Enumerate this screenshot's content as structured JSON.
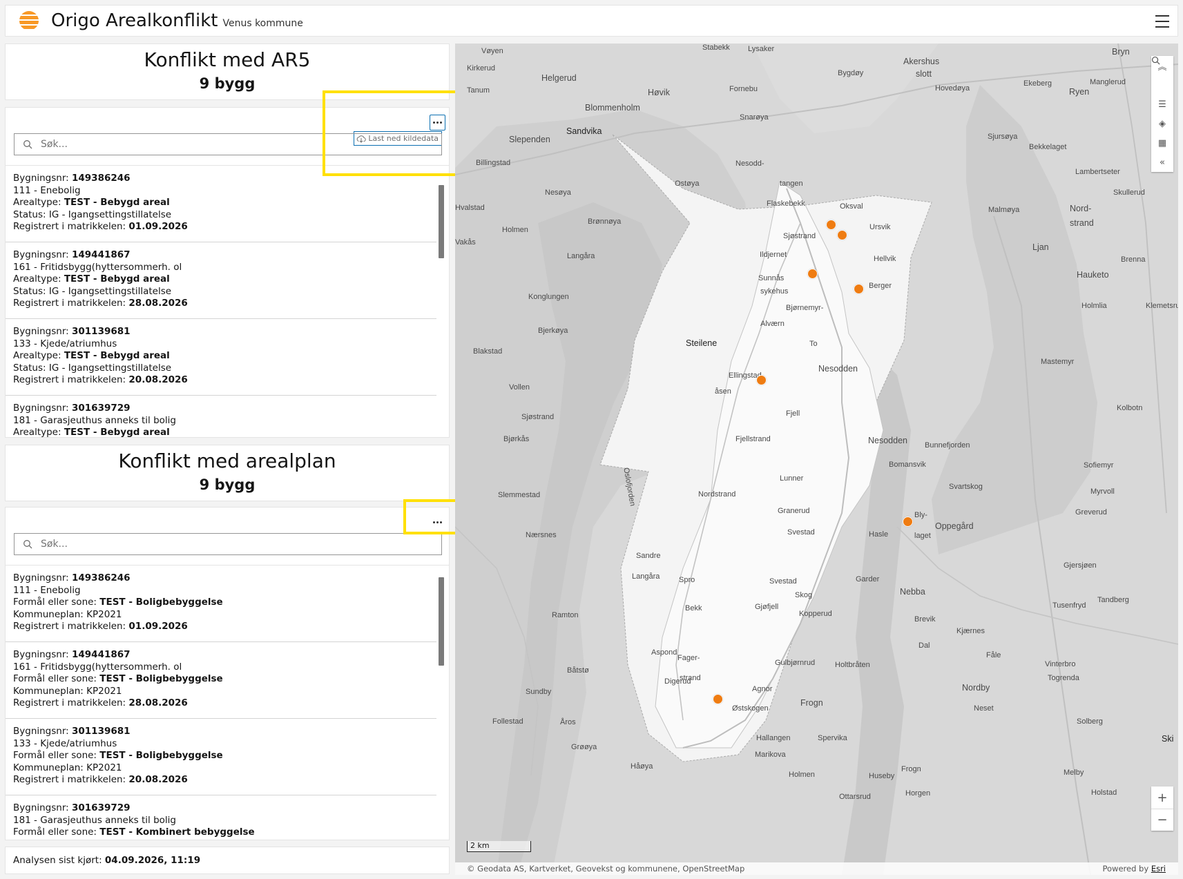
{
  "header": {
    "title": "Origo Arealkonflikt",
    "subtitle": "Venus kommune"
  },
  "ar5": {
    "title": "Konflikt med AR5",
    "count": "9 bygg",
    "download_label": "Last ned kildedata",
    "search_placeholder": "Søk...",
    "items": [
      {
        "l1": "Bygningsnr: ",
        "v1": "149386246",
        "l2": "111 - Enebolig",
        "l3": "Arealtype: ",
        "v3": "TEST - Bebygd areal",
        "l4": "Status: IG - Igangsettingstillatelse",
        "l5": "Registrert i matrikkelen: ",
        "v5": "01.09.2026"
      },
      {
        "l1": "Bygningsnr: ",
        "v1": "149441867",
        "l2": "161 - Fritidsbygg(hyttersommerh. ol",
        "l3": "Arealtype: ",
        "v3": "TEST - Bebygd areal",
        "l4": "Status: IG - Igangsettingstillatelse",
        "l5": "Registrert i matrikkelen: ",
        "v5": "28.08.2026"
      },
      {
        "l1": "Bygningsnr: ",
        "v1": "301139681",
        "l2": "133 - Kjede/atriumhus",
        "l3": "Arealtype: ",
        "v3": "TEST - Bebygd areal",
        "l4": "Status: IG - Igangsettingstillatelse",
        "l5": "Registrert i matrikkelen: ",
        "v5": "20.08.2026"
      },
      {
        "l1": "Bygningsnr: ",
        "v1": "301639729",
        "l2": "181 - Garasjeuthus anneks til bolig",
        "l3": "Arealtype: ",
        "v3": "TEST - Bebygd areal",
        "l4": "",
        "l5": "",
        "v5": ""
      }
    ]
  },
  "plan": {
    "title": "Konflikt med arealplan",
    "count": "9 bygg",
    "search_placeholder": "Søk...",
    "items": [
      {
        "l1": "Bygningsnr: ",
        "v1": "149386246",
        "l2": "111 - Enebolig",
        "l3": "Formål eller sone: ",
        "v3": "TEST - Boligbebyggelse",
        "l4": "Kommuneplan: KP2021",
        "l5": "Registrert i matrikkelen: ",
        "v5": "01.09.2026"
      },
      {
        "l1": "Bygningsnr: ",
        "v1": "149441867",
        "l2": "161 - Fritidsbygg(hyttersommerh. ol",
        "l3": "Formål eller sone: ",
        "v3": "TEST - Boligbebyggelse",
        "l4": "Kommuneplan: KP2021",
        "l5": "Registrert i matrikkelen: ",
        "v5": "28.08.2026"
      },
      {
        "l1": "Bygningsnr: ",
        "v1": "301139681",
        "l2": "133 - Kjede/atriumhus",
        "l3": "Formål eller sone: ",
        "v3": "TEST - Boligbebyggelse",
        "l4": "Kommuneplan: KP2021",
        "l5": "Registrert i matrikkelen: ",
        "v5": "20.08.2026"
      },
      {
        "l1": "Bygningsnr: ",
        "v1": "301639729",
        "l2": "181 - Garasjeuthus anneks til bolig",
        "l3": "Formål eller sone: ",
        "v3": "TEST - Kombinert bebyggelse",
        "l4": "",
        "l5": "",
        "v5": ""
      }
    ]
  },
  "footer": {
    "label": "Analysen sist kjørt: ",
    "value": "04.09.2026, 11:19"
  },
  "map": {
    "scale_label": "2 km",
    "attribution": "Geodata AS, Kartverket, Geovekst og kommunene, OpenStreetMap",
    "powered_by": "Powered by ",
    "powered_link": "Esri",
    "marker_color": "#ef7c12",
    "tools": [
      "chevrons-up-icon",
      "search-icon",
      "list-icon",
      "layers-icon",
      "qr-icon",
      "chevrons-left-icon"
    ],
    "zoom_in": "+",
    "zoom_out": "−",
    "places": [
      "Nesodd-",
      "tangen",
      "Flaskebekk",
      "Oksval",
      "Ursvik",
      "Sjøstrand",
      "Ildjernet",
      "Hellvik",
      "Berger",
      "Sunnås",
      "sykehus",
      "Bjørnemyr-",
      "Alværn",
      "Steilene",
      "To",
      "Ellingstad-",
      "åsen",
      "Nesodden",
      "Nesodden",
      "Fjell",
      "Bomansvik",
      "Fjellstrand",
      "Lunner",
      "Nordstrand",
      "Granerud",
      "Bly-",
      "laget",
      "Svestad",
      "Hasle",
      "Spro",
      "Svestad",
      "Skog",
      "Bekk",
      "Gjøfjell",
      "Kopperud",
      "Fager-",
      "strand",
      "Gulbjørnrud",
      "Agnor",
      "Østskogen",
      "Sandvika",
      "Blommenholm",
      "Høvik",
      "Helgerud",
      "Slependen",
      "Akershus",
      "slott",
      "Bygdøy",
      "Ekeberg",
      "Ryen",
      "Oppegård",
      "Nebba",
      "Frogn",
      "Nordby",
      "Oslofjorden",
      "Bunnefjorden",
      "Vøyen",
      "Kirkerud",
      "Tanum",
      "Stabekk",
      "Lysaker",
      "Fornebu",
      "Snarøya",
      "Billingstad",
      "Nesøya",
      "Ostøya",
      "Hvalstad",
      "Brønnøya",
      "Holmen",
      "Vakås",
      "Langåra",
      "Konglungen",
      "Bjerkøya",
      "Blakstad",
      "Vollen",
      "Sjøstrand",
      "Bjørkås",
      "Slemmestad",
      "Nærsnes",
      "Sandre",
      "Langåra",
      "Ramton",
      "Aspond",
      "Båtstø",
      "Digerud",
      "Sundby",
      "Follestad",
      "Åros",
      "Grøøya",
      "Håøya",
      "Hallangen",
      "Marikova",
      "Spervika",
      "Holmen",
      "Huseby",
      "Ottarsrud",
      "Horgen",
      "Frogn",
      "Holtbråten",
      "Garder",
      "Brevik",
      "Dal",
      "Kjærnes",
      "Fåle",
      "Vinterbro",
      "Togrenda",
      "Neset",
      "Solberg",
      "Melby",
      "Holstad",
      "Tandberg",
      "Tusenfryd",
      "Gjersjøen",
      "Greverud",
      "Myrvoll",
      "Sofiemyr",
      "Svartskog",
      "Kolbotn",
      "Mastemyr",
      "Hauketo",
      "Holmlia",
      "Ljan",
      "Bekkelaget",
      "Sjursøya",
      "Hovedøya",
      "Manglerud",
      "Lambertseter",
      "Skullerud",
      "Nord-",
      "strand",
      "Malmøya",
      "Brenna",
      "Klemetsrud",
      "Bryn",
      "Ski"
    ]
  }
}
